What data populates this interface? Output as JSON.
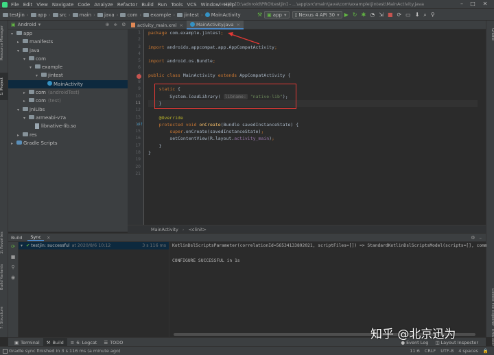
{
  "menu": [
    "File",
    "Edit",
    "View",
    "Navigate",
    "Code",
    "Analyze",
    "Refactor",
    "Build",
    "Run",
    "Tools",
    "VCS",
    "Window",
    "Help"
  ],
  "window_title": "testjin [D:\\adnroid\\PRO\\testjin] - ...\\app\\src\\main\\java\\com\\example\\jintest\\MainActivity.java",
  "breadcrumb": [
    "testjin",
    "app",
    "src",
    "main",
    "java",
    "com",
    "example",
    "jintest",
    "MainActivity"
  ],
  "run_config": "app",
  "device": "Nexus 4 API 30",
  "project_view": "Android",
  "tree": [
    {
      "label": "app",
      "indent": 0,
      "arrow": "▾",
      "icon": "folder"
    },
    {
      "label": "manifests",
      "indent": 1,
      "arrow": "▸",
      "icon": "folder"
    },
    {
      "label": "java",
      "indent": 1,
      "arrow": "▾",
      "icon": "folder"
    },
    {
      "label": "com",
      "indent": 2,
      "arrow": "▾",
      "icon": "folder"
    },
    {
      "label": "example",
      "indent": 3,
      "arrow": "▾",
      "icon": "folder"
    },
    {
      "label": "jintest",
      "indent": 4,
      "arrow": "▾",
      "icon": "folder"
    },
    {
      "label": "MainActivity",
      "indent": 5,
      "arrow": "",
      "icon": "class",
      "selected": true
    },
    {
      "label": "com",
      "suffix": "(androidTest)",
      "indent": 2,
      "arrow": "▸",
      "icon": "folder"
    },
    {
      "label": "com",
      "suffix": "(test)",
      "indent": 2,
      "arrow": "▸",
      "icon": "folder"
    },
    {
      "label": "jniLibs",
      "indent": 1,
      "arrow": "▾",
      "icon": "folder"
    },
    {
      "label": "armeabi-v7a",
      "indent": 2,
      "arrow": "▾",
      "icon": "folder"
    },
    {
      "label": "libnative-lib.so",
      "indent": 3,
      "arrow": "",
      "icon": "file"
    },
    {
      "label": "res",
      "indent": 1,
      "arrow": "▸",
      "icon": "folder"
    },
    {
      "label": "Gradle Scripts",
      "indent": 0,
      "arrow": "▸",
      "icon": "gradle"
    }
  ],
  "editor_tabs": [
    {
      "label": "activity_main.xml",
      "active": false
    },
    {
      "label": "MainActivity.java",
      "active": true
    }
  ],
  "line_numbers": [
    "1",
    "2",
    "3",
    "4",
    "5",
    "6",
    "7",
    "8",
    "9",
    "10",
    "11",
    "12",
    "13",
    "14",
    "15",
    "16",
    "17",
    "18",
    "19",
    "20",
    "21"
  ],
  "code_lines": [
    [
      {
        "t": "package ",
        "c": "kw"
      },
      {
        "t": "com.example.jintest",
        "c": ""
      },
      {
        "t": ";",
        "c": "kw"
      }
    ],
    [],
    [
      {
        "t": "import ",
        "c": "kw"
      },
      {
        "t": "androidx.appcompat.app.AppCompatActivity",
        "c": ""
      },
      {
        "t": ";",
        "c": "kw"
      }
    ],
    [],
    [
      {
        "t": "import ",
        "c": "kw"
      },
      {
        "t": "android.os.Bundle",
        "c": ""
      },
      {
        "t": ";",
        "c": "kw"
      }
    ],
    [],
    [
      {
        "t": "public class ",
        "c": "kw"
      },
      {
        "t": "MainActivity ",
        "c": ""
      },
      {
        "t": "extends ",
        "c": "kw"
      },
      {
        "t": "AppCompatActivity {",
        "c": ""
      }
    ],
    [],
    [
      {
        "t": "    static ",
        "c": "kw"
      },
      {
        "t": "{",
        "c": ""
      }
    ],
    [
      {
        "t": "        System.",
        "c": ""
      },
      {
        "t": "loadLibrary",
        "c": "it"
      },
      {
        "t": "( ",
        "c": ""
      },
      {
        "t": "libname:",
        "c": "hint"
      },
      {
        "t": " ",
        "c": ""
      },
      {
        "t": "\"native-lib\"",
        "c": "str"
      },
      {
        "t": ");",
        "c": ""
      }
    ],
    [
      {
        "t": "    }",
        "c": ""
      }
    ],
    [],
    [
      {
        "t": "    @Override",
        "c": "ann"
      }
    ],
    [
      {
        "t": "    protected void ",
        "c": "kw"
      },
      {
        "t": "onCreate",
        "c": "fn"
      },
      {
        "t": "(Bundle savedInstanceState) {",
        "c": ""
      }
    ],
    [
      {
        "t": "        super",
        "c": "kw"
      },
      {
        "t": ".onCreate(savedInstanceState)",
        "c": ""
      },
      {
        "t": ";",
        "c": "kw"
      }
    ],
    [
      {
        "t": "        setContentView(R.layout.",
        "c": ""
      },
      {
        "t": "activity_main",
        "c": "field"
      },
      {
        "t": ")",
        "c": ""
      },
      {
        "t": ";",
        "c": "kw"
      }
    ],
    [
      {
        "t": "    }",
        "c": ""
      }
    ],
    [
      {
        "t": "}",
        "c": ""
      }
    ],
    [],
    [],
    []
  ],
  "editor_crumb": [
    "MainActivity",
    "<clinit>"
  ],
  "build_tabs": [
    "Build",
    "Sync"
  ],
  "build_tree": {
    "label": "testjin: successful",
    "time_note": "at 2020/8/6 10:12",
    "duration": "3 s 116 ms"
  },
  "build_output": [
    "KotlinDslScriptsParameter(correlationId=56534133892021, scriptFiles=[]) => StandardKotlinDslScriptsModel(scripts=[], comm",
    "",
    "CONFIGURE SUCCESSFUL in 1s"
  ],
  "tool_tabs": [
    "Terminal",
    "Build",
    "6: Logcat",
    "TODO"
  ],
  "right_tools": [
    "Event Log",
    "Layout Inspector"
  ],
  "status_message": "Gradle sync finished in 3 s 116 ms (a minute ago)",
  "status_right": [
    "11:6",
    "CRLF",
    "UTF-8",
    "4 spaces"
  ],
  "left_stripe_labels": [
    "Resource Manager",
    "1: Project",
    "2: Favorites",
    "Build Variants",
    "7: Structure"
  ],
  "right_stripe_labels": [
    "Gradle",
    "Device File Explorer",
    "Emulator"
  ],
  "watermark": "知乎 @北京迅为"
}
